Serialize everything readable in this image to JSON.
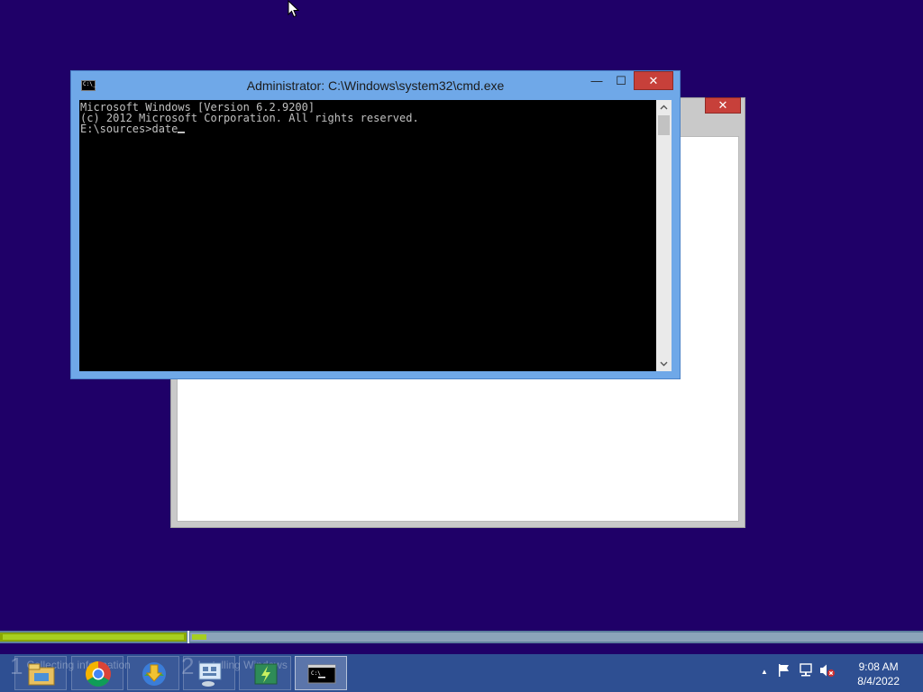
{
  "cmd": {
    "title": "Administrator: C:\\Windows\\system32\\cmd.exe",
    "icon_text": "C:\\_",
    "minimize_glyph": "—",
    "maximize_glyph": "☐",
    "close_glyph": "✕",
    "lines": [
      "Microsoft Windows [Version 6.2.9200]",
      "(c) 2012 Microsoft Corporation. All rights reserved.",
      "",
      "E:\\sources>date"
    ]
  },
  "setup_window": {
    "close_glyph": "✕"
  },
  "progress": {
    "stages": [
      {
        "number": "1",
        "label": "Collecting information",
        "progress": 1.0
      },
      {
        "number": "2",
        "label": "Installing Windows",
        "progress": 0.02
      }
    ]
  },
  "taskbar": {
    "apps": [
      {
        "name": "file-explorer-icon"
      },
      {
        "name": "chrome-icon"
      },
      {
        "name": "internet-download-manager-icon"
      },
      {
        "name": "network-app-icon"
      },
      {
        "name": "windows-setup-icon"
      },
      {
        "name": "command-prompt-icon",
        "active": true
      }
    ],
    "tray": {
      "show_hidden_glyph": "▲",
      "time": "9:08 AM",
      "date": "8/4/2022"
    }
  },
  "colors": {
    "desktop": "#1f0068",
    "window_frame": "#6fa8e8",
    "close_button": "#c7403a",
    "progress_green": "#a6cf20",
    "taskbar": "#2e4f92"
  }
}
